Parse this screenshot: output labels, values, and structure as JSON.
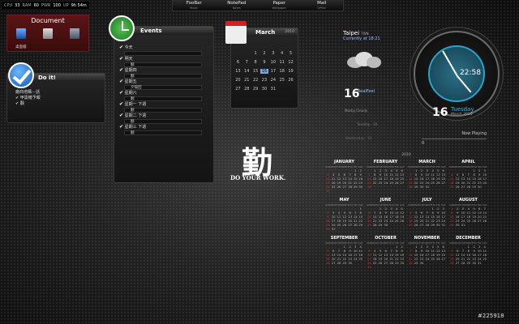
{
  "statbar": {
    "cpu_label": "CPU",
    "cpu": "33",
    "ram_label": "RAM",
    "ram": "60",
    "pwr_label": "PWR",
    "pwr": "100",
    "up_label": "UP",
    "up": "9h 54m"
  },
  "topbar": [
    {
      "label": "FooBar",
      "sub": "Music"
    },
    {
      "label": "NotePad",
      "sub": "Notes"
    },
    {
      "label": "Paper",
      "sub": "Wallpaper"
    },
    {
      "label": "Mail",
      "sub": "Office"
    }
  ],
  "document": {
    "title": "Document",
    "label": "桌面檔"
  },
  "doit": {
    "title": "Do it!",
    "items": [
      "廠商增購－話",
      "甲需確予報",
      "翻"
    ]
  },
  "events": {
    "title": "Events",
    "entries": [
      {
        "label": "今天",
        "sub": ""
      },
      {
        "label": "明天",
        "sub": "翻"
      },
      {
        "label": "星期四",
        "sub": "翻"
      },
      {
        "label": "星期五",
        "sub": "夕陽回"
      },
      {
        "label": "星期六",
        "sub": "翻"
      },
      {
        "label": "星期一 下週",
        "sub": "翻"
      },
      {
        "label": "星期二 下週",
        "sub": "翻"
      },
      {
        "label": "星期三 下週",
        "sub": "翻"
      }
    ]
  },
  "calendar": {
    "month": "March",
    "year": "2010",
    "days": [
      "",
      "",
      "1",
      "2",
      "3",
      "4",
      "5",
      "6",
      "7",
      "8",
      "9",
      "10",
      "11",
      "12",
      "13",
      "14",
      "15",
      "16",
      "17",
      "18",
      "19",
      "20",
      "21",
      "22",
      "23",
      "24",
      "25",
      "26",
      "27",
      "28",
      "29",
      "30",
      "31",
      "",
      "",
      ""
    ],
    "today": "16"
  },
  "weather": {
    "city": "Taipei",
    "country": "TWN",
    "currently": "Currently at 18:21",
    "temp": "16",
    "feels": "RealFeel",
    "desc": "Mostly Cloudy",
    "day2": "Tuesday",
    "day3": "Wednesday",
    "temp2": "16",
    "temp3": "19"
  },
  "clock": {
    "time": "22:58",
    "day_num": "16",
    "day_name": "Tuesday",
    "month_year": "March 2010"
  },
  "nowplaying": {
    "label": "Now Playing",
    "value": "0"
  },
  "kanji": {
    "char": "勤",
    "motto": "DO YOUR WORK."
  },
  "year_calendar": {
    "year": "2010",
    "weekdays": [
      "SUN",
      "MON",
      "TUE",
      "WED",
      "THU",
      "FRI",
      "SAT"
    ],
    "months": [
      {
        "name": "JANUARY",
        "start": 5,
        "len": 31
      },
      {
        "name": "FEBRUARY",
        "start": 1,
        "len": 28
      },
      {
        "name": "MARCH",
        "start": 1,
        "len": 31
      },
      {
        "name": "APRIL",
        "start": 4,
        "len": 30
      },
      {
        "name": "MAY",
        "start": 6,
        "len": 31
      },
      {
        "name": "JUNE",
        "start": 2,
        "len": 30
      },
      {
        "name": "JULY",
        "start": 4,
        "len": 31
      },
      {
        "name": "AUGUST",
        "start": 0,
        "len": 31
      },
      {
        "name": "SEPTEMBER",
        "start": 3,
        "len": 30
      },
      {
        "name": "OCTOBER",
        "start": 5,
        "len": 31
      },
      {
        "name": "NOVEMBER",
        "start": 1,
        "len": 30
      },
      {
        "name": "DECEMBER",
        "start": 3,
        "len": 31
      }
    ]
  },
  "watermark": "#225918"
}
